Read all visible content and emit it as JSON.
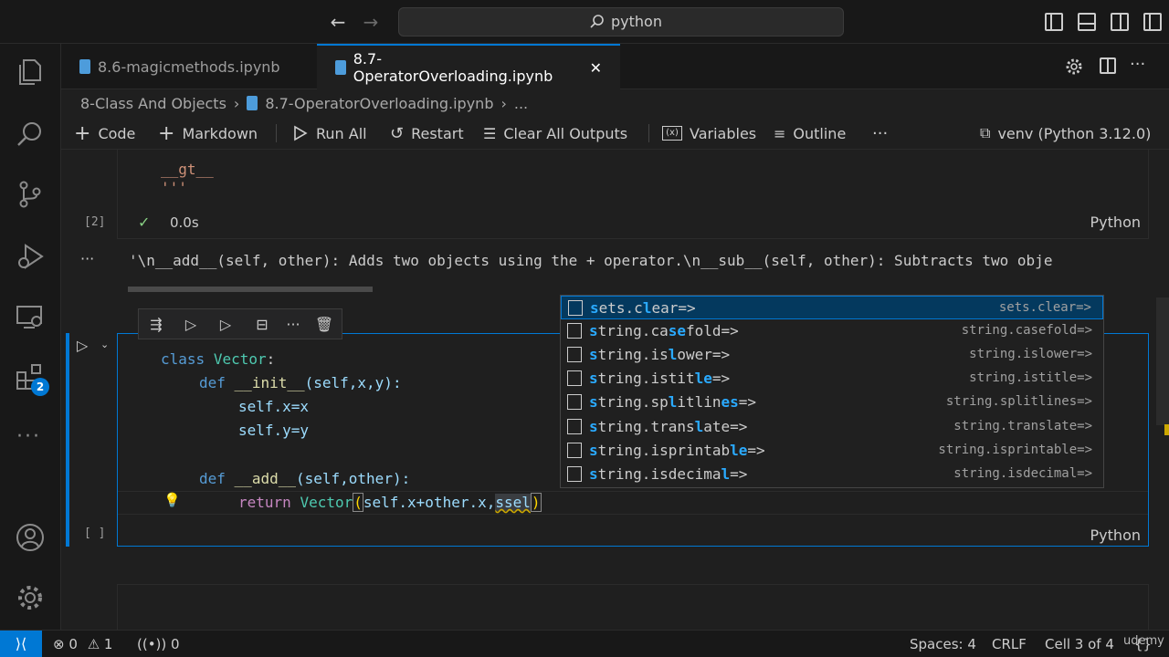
{
  "titlebar": {
    "search_text": "python"
  },
  "activity": {
    "extensions_badge": "2"
  },
  "tabs": [
    {
      "label": "8.6-magicmethods.ipynb"
    },
    {
      "label": "8.7-OperatorOverloading.ipynb",
      "close": "✕"
    }
  ],
  "breadcrumb": {
    "folder": "8-Class And Objects",
    "file": "8.7-OperatorOverloading.ipynb",
    "more": "..."
  },
  "toolbar": {
    "code": "Code",
    "markdown": "Markdown",
    "run_all": "Run All",
    "restart": "Restart",
    "clear_outputs": "Clear All Outputs",
    "variables": "Variables",
    "outline": "Outline",
    "more": "···",
    "kernel": "venv (Python 3.12.0)"
  },
  "cell2": {
    "lines": [
      "__gt__",
      "'''"
    ],
    "exec_count": "[2]",
    "check": "✓",
    "duration": "0.0s",
    "language": "Python",
    "output_ellipsis": "···",
    "output": "'\\n__add__(self, other): Adds two objects using the + operator.\\n__sub__(self, other): Subtracts two obje"
  },
  "cell3": {
    "exec_count": "[ ]",
    "language": "Python",
    "code": {
      "l1_kw": "class",
      "l1_name": "Vector",
      "l1_end": ":",
      "l2_kw": "def",
      "l2_fn": "__init__",
      "l2_args": "(self,x,y):",
      "l3": "self.x=x",
      "l4": "self.y=y",
      "l6_kw": "def",
      "l6_fn": "__add__",
      "l6_args": "(self,other):",
      "l7_kw": "return",
      "l7_cls": "Vector",
      "l7_open": "(",
      "l7_args": "self.x+other.x,",
      "l7_typed": "ssel",
      "l7_close": ")"
    }
  },
  "suggestions": [
    {
      "pre": "",
      "hl1": "s",
      "mid": "",
      "hl2": "",
      "rest": "ets.clear=>",
      "detail": "sets.clear=>",
      "full": [
        "s",
        "e",
        "ts.c",
        "l",
        "ear=>"
      ]
    },
    {
      "detail": "string.casefold=>"
    },
    {
      "detail": "string.islower=>"
    },
    {
      "detail": "string.istitle=>"
    },
    {
      "detail": "string.splitlines=>"
    },
    {
      "detail": "string.translate=>"
    },
    {
      "detail": "string.isprintable=>"
    },
    {
      "detail": "string.isdecimal=>"
    }
  ],
  "suggest_labels": [
    [
      [
        "s",
        1
      ],
      [
        "e",
        0
      ],
      [
        "ts.c",
        0
      ],
      [
        "l",
        1
      ],
      [
        "ear=>",
        0
      ]
    ],
    [
      [
        "s",
        1
      ],
      [
        "tring.ca",
        0
      ],
      [
        "se",
        1
      ],
      [
        "fold=>",
        0
      ]
    ],
    [
      [
        "s",
        1
      ],
      [
        "tring.is",
        0
      ],
      [
        "l",
        1
      ],
      [
        "ower=>",
        0
      ]
    ],
    [
      [
        "s",
        1
      ],
      [
        "tring.is",
        0
      ],
      [
        "t",
        0
      ],
      [
        "i",
        0
      ],
      [
        "t",
        0
      ],
      [
        "le",
        1
      ],
      [
        "=>",
        0
      ]
    ],
    [
      [
        "s",
        1
      ],
      [
        "tring.sp",
        0
      ],
      [
        "l",
        1
      ],
      [
        "itlin",
        0
      ],
      [
        "es",
        1
      ],
      [
        "=>",
        0
      ]
    ],
    [
      [
        "s",
        1
      ],
      [
        "tring.tr",
        0
      ],
      [
        "a",
        0
      ],
      [
        "ns",
        0
      ],
      [
        "l",
        1
      ],
      [
        "ate=>",
        0
      ]
    ],
    [
      [
        "s",
        1
      ],
      [
        "tring.is",
        0
      ],
      [
        "printab",
        0
      ],
      [
        "le",
        1
      ],
      [
        "=>",
        0
      ]
    ],
    [
      [
        "s",
        1
      ],
      [
        "tring.is",
        0
      ],
      [
        "decima",
        0
      ],
      [
        "l",
        1
      ],
      [
        "=>",
        0
      ]
    ]
  ],
  "status": {
    "errors": "0",
    "warnings": "1",
    "ports": "0",
    "spaces": "Spaces: 4",
    "eol": "CRLF",
    "cell": "Cell 3 of 4",
    "braces": "{}",
    "watermark": "udemy"
  }
}
